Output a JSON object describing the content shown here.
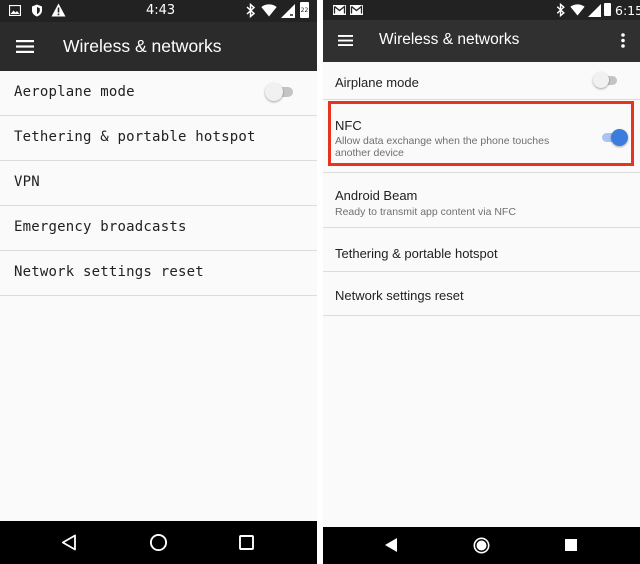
{
  "left": {
    "status": {
      "time": "4:43",
      "icons": [
        "image-notification-icon",
        "shield-notification-icon",
        "warning-icon",
        "bluetooth-icon",
        "wifi-icon",
        "signal-icon",
        "battery-icon"
      ],
      "battery_label": "22"
    },
    "appbar": {
      "title": "Wireless & networks",
      "menu_icon": "hamburger-menu-icon"
    },
    "items": [
      {
        "label": "Aeroplane mode",
        "toggle": "off"
      },
      {
        "label": "Tethering & portable hotspot"
      },
      {
        "label": "VPN"
      },
      {
        "label": "Emergency broadcasts"
      },
      {
        "label": "Network settings reset"
      }
    ],
    "nav": [
      "back-icon",
      "home-icon",
      "recents-icon"
    ]
  },
  "right": {
    "status": {
      "time": "6:15",
      "icons": [
        "gmail-icon",
        "gmail-icon",
        "bluetooth-icon",
        "wifi-icon",
        "signal-icon",
        "battery-icon"
      ]
    },
    "appbar": {
      "title": "Wireless & networks",
      "menu_icon": "hamburger-menu-icon",
      "overflow_icon": "more-vert-icon"
    },
    "items": [
      {
        "label": "Airplane mode",
        "toggle": "off"
      },
      {
        "label": "NFC",
        "summary": "Allow data exchange when the phone touches another device",
        "toggle": "on",
        "highlighted": true
      },
      {
        "label": "Android Beam",
        "summary": "Ready to transmit app content via NFC"
      },
      {
        "label": "Tethering & portable hotspot"
      },
      {
        "label": "Network settings reset"
      }
    ],
    "nav": [
      "back-icon",
      "home-icon",
      "recents-icon"
    ]
  },
  "colors": {
    "toggle_on": "#3b7ddd",
    "toggle_on_track": "#a9c6f1",
    "toggle_off_thumb": "#f1f1f1",
    "toggle_off_track": "#bdbdbd",
    "highlight_border": "#e8341c",
    "appbar": "#303030",
    "statusbar": "#222222"
  }
}
